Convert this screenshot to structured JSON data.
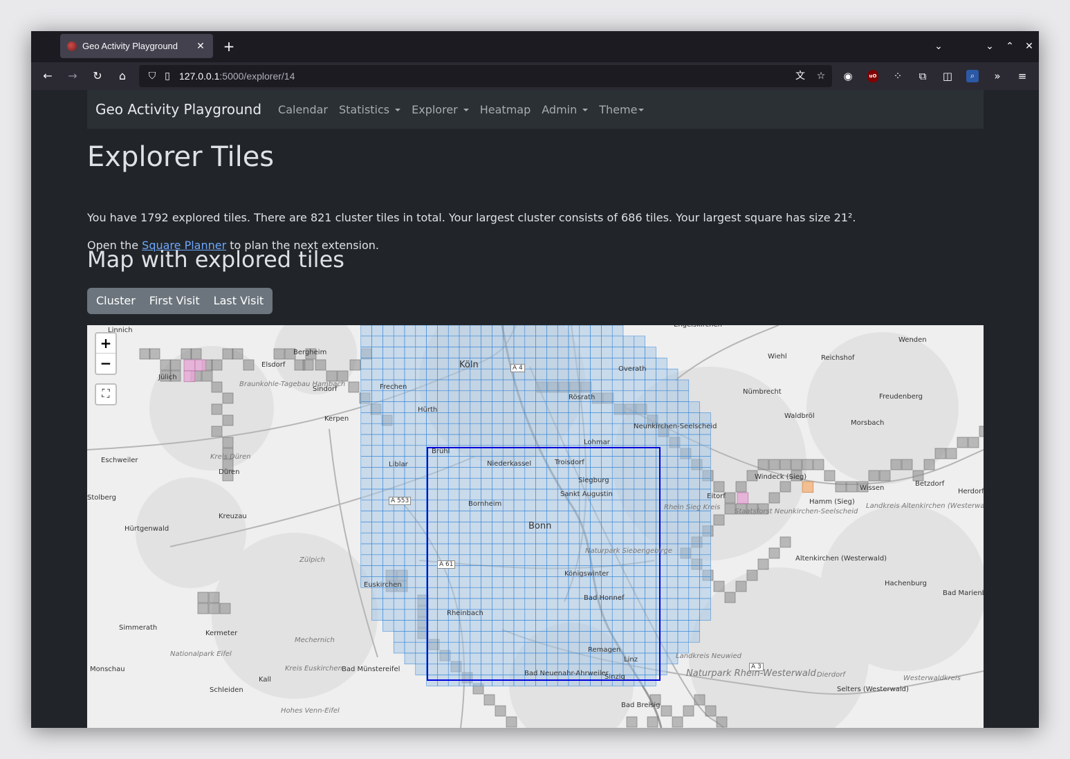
{
  "browser": {
    "tab_title": "Geo Activity Playground",
    "url_host": "127.0.0.1",
    "url_path": ":5000/explorer/14"
  },
  "nav": {
    "brand": "Geo Activity Playground",
    "items": [
      "Calendar",
      "Statistics",
      "Explorer",
      "Heatmap",
      "Admin",
      "Theme"
    ]
  },
  "page": {
    "title": "Explorer Tiles",
    "summary": "You have 1792 explored tiles. There are 821 cluster tiles in total. Your largest cluster consists of 686 tiles. Your largest square has size 21².",
    "planner_prefix": "Open the ",
    "planner_link": "Square Planner",
    "planner_suffix": " to plan the next extension.",
    "map_heading": "Map with explored tiles",
    "buttons": [
      "Cluster",
      "First Visit",
      "Last Visit"
    ]
  },
  "map": {
    "zoom_in": "+",
    "zoom_out": "−",
    "colors": {
      "cluster_fill": "#a9c8e6",
      "cluster_line": "#2a7fd6",
      "explored_fill": "#8a8a8a",
      "square_line": "#0000dd",
      "pink": "#e6a9d6",
      "orange": "#f2b27a"
    },
    "labels": [
      "Linnich",
      "Jülich",
      "Elsdorf",
      "Bergheim",
      "Köln",
      "Engelskirchen",
      "Wenden",
      "Wiehl",
      "Reichshof",
      "Overath",
      "Frechen",
      "Sindorf",
      "Braunkohle-Tagebau Hambach",
      "Hürth",
      "Kerpen",
      "Rösrath",
      "Nümbrecht",
      "Waldbröl",
      "Freudenberg",
      "Morsbach",
      "Neunkirchen-Seelscheid",
      "Lohmar",
      "Eschweiler",
      "Kreis Düren",
      "Düren",
      "Brühl",
      "Liblar",
      "Niederkassel",
      "Troisdorf",
      "Siegburg",
      "Sankt Augustin",
      "Windeck (Sieg)",
      "Wissen",
      "Betzdorf",
      "Herdorf",
      "Hamm (Sieg)",
      "Stolberg",
      "Kreuzau",
      "Bornheim",
      "Eitorf",
      "Rhein Sieg Kreis",
      "Staatsforst Neunkirchen-Seelscheid",
      "Landkreis Altenkirchen (Westerwald)",
      "Bonn",
      "Hürtgenwald",
      "Zülpich",
      "Naturpark Siebengebirge",
      "Königswinter",
      "Altenkirchen (Westerwald)",
      "Euskirchen",
      "Hachenburg",
      "Bad Marienberg",
      "Bad Honnef",
      "Rheinbach",
      "Simmerath",
      "Kermeter",
      "Mechernich",
      "Nationalpark Eifel",
      "Remagen",
      "Linz",
      "Landkreis Neuwied",
      "Naturpark Rhein-Westerwald",
      "Monschau",
      "Kreis Euskirchen",
      "Bad Münstereifel",
      "Bad Neuenahr-Ahrweiler",
      "Sinzig",
      "Dierdorf",
      "Selters (Westerwald)",
      "Westerwaldkreis",
      "Kall",
      "Schleiden",
      "Hohes Venn-Eifel",
      "Bad Breisig",
      "A 3",
      "A 4",
      "A 553",
      "A 61"
    ]
  }
}
